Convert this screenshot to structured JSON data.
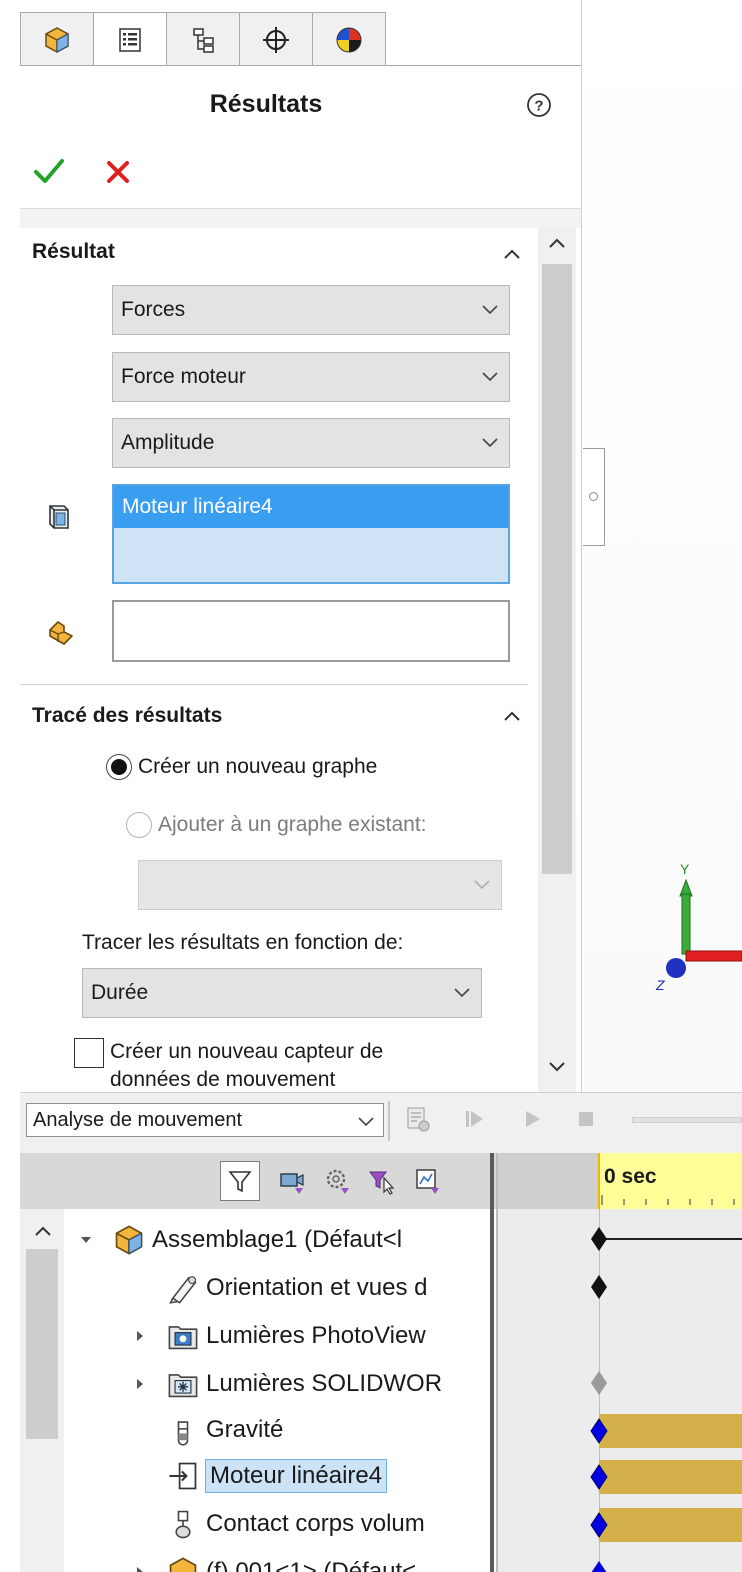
{
  "property_manager": {
    "tabs": [
      {
        "name": "feature-manager",
        "icon": "assembly-icon"
      },
      {
        "name": "property-manager",
        "icon": "property-list-icon"
      },
      {
        "name": "configuration-manager",
        "icon": "configuration-icon"
      },
      {
        "name": "dimxpert-manager",
        "icon": "crosshair-icon"
      },
      {
        "name": "display-manager",
        "icon": "appearance-icon"
      }
    ],
    "title": "Résultats",
    "help_icon": "help-icon",
    "ok_icon": "checkmark-icon",
    "cancel_icon": "close-icon"
  },
  "result_group": {
    "title": "Résultat",
    "category": "Forces",
    "subcategory": "Force moteur",
    "component": "Amplitude",
    "selection_items": [
      "Moteur linéaire4"
    ],
    "second_selection_value": ""
  },
  "plot_group": {
    "title": "Tracé des résultats",
    "new_graph_label": "Créer un nouveau graphe",
    "new_graph_selected": true,
    "add_existing_label": "Ajouter à un graphe existant:",
    "existing_graph_value": "",
    "plot_against_label": "Tracer les résultats en fonction de:",
    "plot_against_value": "Durée",
    "new_sensor_label_1": "Créer un nouveau capteur de",
    "new_sensor_label_2": "données de mouvement",
    "new_sensor_checked": false
  },
  "motion_manager": {
    "study_type": "Analyse de mouvement",
    "time_label": "0 sec",
    "tree": [
      {
        "label": "Assemblage1  (Défaut<l",
        "icon": "assembly-icon",
        "expander": "expanded",
        "level": 0
      },
      {
        "label": "Orientation et vues d",
        "icon": "camera-icon",
        "expander": "none",
        "level": 1
      },
      {
        "label": "Lumières PhotoView",
        "icon": "photoview-lights-folder-icon",
        "expander": "collapsed",
        "level": 1
      },
      {
        "label": "Lumières SOLIDWOR",
        "icon": "solidworks-lights-folder-icon",
        "expander": "collapsed",
        "level": 1
      },
      {
        "label": "Gravité",
        "icon": "gravity-icon",
        "expander": "none",
        "level": 1
      },
      {
        "label": "Moteur linéaire4",
        "icon": "linear-motor-icon",
        "expander": "none",
        "level": 1,
        "selected": true
      },
      {
        "label": "Contact corps volum",
        "icon": "contact-icon",
        "expander": "none",
        "level": 1
      },
      {
        "label": "(f) 001<1> (Défaut<",
        "icon": "part-icon",
        "expander": "collapsed",
        "level": 1
      }
    ]
  },
  "colors": {
    "selection_blue": "#3a9ef0",
    "timebar_gold": "#d4b04a",
    "timeline_header_yellow": "#ffff99",
    "ok_green": "#22a32a",
    "cancel_red": "#e02020"
  }
}
